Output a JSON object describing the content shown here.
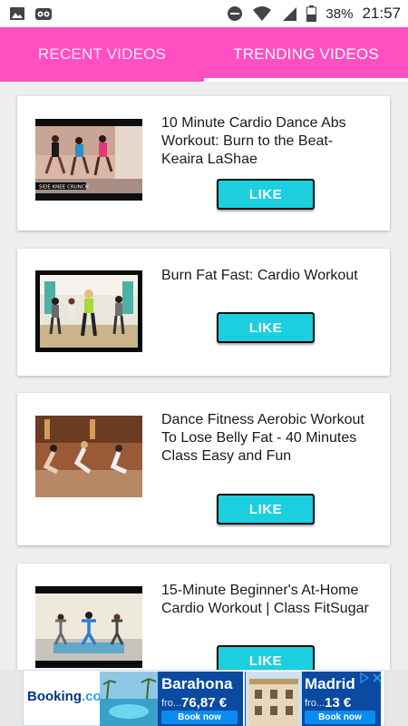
{
  "status_bar": {
    "battery": "38%",
    "time": "21:57"
  },
  "tabs": [
    {
      "label": "RECENT VIDEOS",
      "active": false
    },
    {
      "label": "TRENDING VIDEOS",
      "active": true
    }
  ],
  "videos": [
    {
      "title": "10 Minute Cardio Dance Abs Workout: Burn to the Beat- Keaira LaShae",
      "thumb_caption": "SIDE KNEE CRUNCH",
      "like_label": "LIKE"
    },
    {
      "title": "Burn Fat Fast: Cardio Workout",
      "like_label": "LIKE"
    },
    {
      "title": "Dance Fitness Aerobic Workout To Lose Belly Fat - 40 Minutes Class Easy and Fun",
      "like_label": "LIKE"
    },
    {
      "title": "15-Minute Beginner's At-Home Cardio Workout | Class FitSugar",
      "like_label": "LIKE"
    }
  ],
  "ad": {
    "brand_name": "Booking",
    "brand_suffix": ".com",
    "offers": [
      {
        "city": "Barahona",
        "from": "fro...",
        "price": "76,87 €",
        "button": "Book now"
      },
      {
        "city": "Madrid",
        "from": "fro...",
        "price": "13 €",
        "button": "Book now"
      }
    ]
  },
  "colors": {
    "tab_bar": "#ff4fc1",
    "like_button": "#1ccfdf",
    "booking_blue": "#0a4aa1"
  }
}
